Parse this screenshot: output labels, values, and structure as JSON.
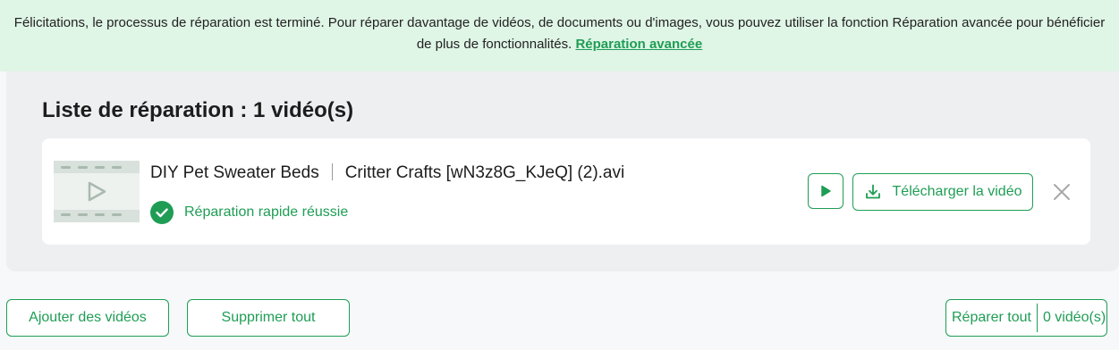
{
  "banner": {
    "message": "Félicitations, le processus de réparation est terminé. Pour réparer davantage de vidéos, de documents ou d'images, vous pouvez utiliser la fonction Réparation avancée pour bénéficier de plus de fonctionnalités.",
    "link": "Réparation avancée"
  },
  "list": {
    "title": "Liste de réparation : 1 vidéo(s)",
    "items": [
      {
        "name_part1": "DIY Pet Sweater Beds",
        "name_part2": "Critter Crafts [wN3z8G_KJeQ] (2).avi",
        "status": "Réparation rapide réussie",
        "download_label": "Télécharger la vidéo"
      }
    ]
  },
  "footer": {
    "add_label": "Ajouter des vidéos",
    "remove_all_label": "Supprimer tout",
    "repair_all_label": "Réparer tout",
    "repair_count": "0 vidéo(s)"
  },
  "colors": {
    "accent": "#1f9d55",
    "banner_bg": "#dff5e6",
    "panel_bg": "#eeeff0"
  },
  "icons": {
    "thumb": "video-thumbnail-icon",
    "status": "check-circle-icon",
    "play": "play-icon",
    "download": "download-icon",
    "close": "close-icon"
  }
}
